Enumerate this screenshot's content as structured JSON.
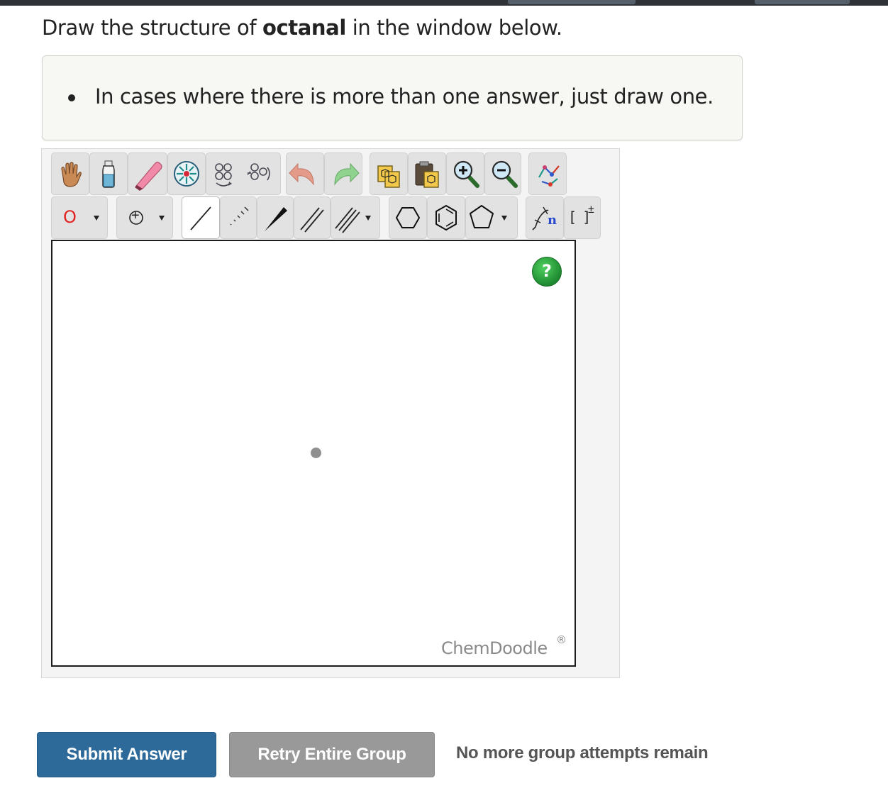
{
  "question": {
    "prefix": "Draw the structure of ",
    "compound": "octanal",
    "suffix": " in the window below."
  },
  "hint": {
    "items": [
      "In cases where there is more than one answer, just draw one."
    ]
  },
  "toolbar": {
    "row1": [
      {
        "icon": "hand-icon"
      },
      {
        "icon": "clear-bottle-icon"
      },
      {
        "icon": "eraser-icon"
      },
      {
        "icon": "center-icon"
      },
      {
        "icon": "flip-rotate-icon"
      },
      {
        "icon": "undo-icon"
      },
      {
        "icon": "redo-icon"
      },
      {
        "icon": "copy-icon"
      },
      {
        "icon": "paste-icon"
      },
      {
        "icon": "zoom-in-icon"
      },
      {
        "icon": "zoom-out-icon"
      },
      {
        "icon": "clean-structure-icon"
      }
    ],
    "row2": {
      "atom_label": "O",
      "charge_label": "+",
      "bond_tools": [
        "single-bond-icon",
        "hash-bond-icon",
        "wedge-bond-icon",
        "double-bond-icon",
        "triple-bond-icon"
      ],
      "ring_tools": [
        "cyclohexane-icon",
        "benzene-icon",
        "cyclopentane-icon"
      ],
      "repeat_unit_label": "n",
      "bracket_label": "[ ]",
      "bracket_charge": "±"
    }
  },
  "canvas": {
    "help_label": "?",
    "watermark": "ChemDoodle",
    "watermark_reg": "®"
  },
  "actions": {
    "submit_label": "Submit Answer",
    "retry_label": "Retry Entire Group",
    "status_text": "No more group attempts remain"
  },
  "colors": {
    "submit_bg": "#2d6a99",
    "retry_bg": "#999999",
    "help_green": "#2aa83b",
    "oxygen_red": "#e32222"
  }
}
